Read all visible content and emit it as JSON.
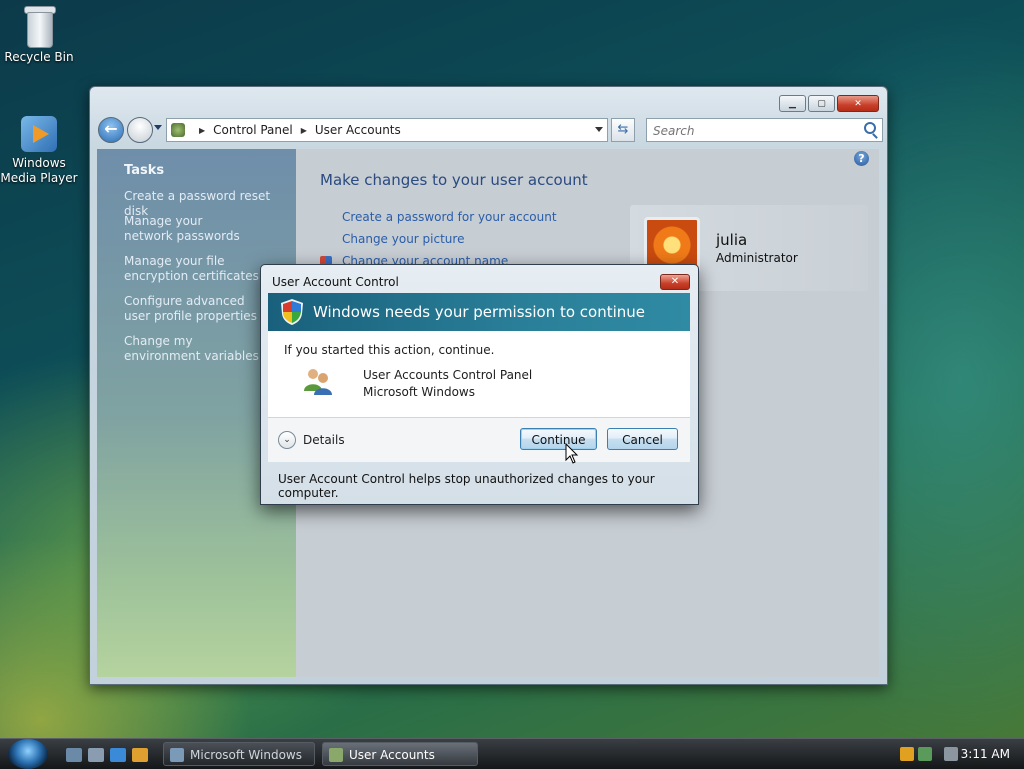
{
  "desktop": {
    "icons": [
      {
        "label": "Recycle Bin"
      },
      {
        "label": "Windows Media Player"
      }
    ]
  },
  "window": {
    "breadcrumb": [
      "Control Panel",
      "User Accounts"
    ],
    "search_placeholder": "Search",
    "tasks_title": "Tasks",
    "tasks": [
      "Create a password reset disk",
      "Manage your network passwords",
      "Manage your file encryption certificates",
      "Configure advanced user profile properties",
      "Change my environment variables"
    ],
    "heading": "Make changes to your user account",
    "links": [
      "Create a password for your account",
      "Change your picture",
      "Change your account name"
    ],
    "user": {
      "name": "julia",
      "role": "Administrator"
    }
  },
  "uac": {
    "title": "User Account Control",
    "banner": "Windows needs your permission to continue",
    "prompt": "If you started this action, continue.",
    "program_name": "User Accounts Control Panel",
    "publisher": "Microsoft Windows",
    "details_label": "Details",
    "continue_label": "Continue",
    "cancel_label": "Cancel",
    "footer": "User Account Control helps stop unauthorized changes to your computer."
  },
  "taskbar": {
    "buttons": [
      "Microsoft Windows",
      "User Accounts"
    ],
    "clock": "3:11 AM"
  }
}
